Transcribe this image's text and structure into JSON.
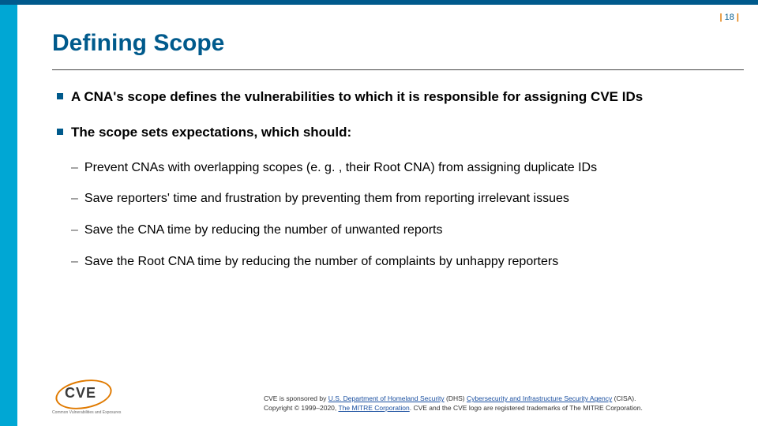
{
  "page": {
    "num": "18"
  },
  "title": "Defining Scope",
  "bullets": [
    {
      "level": 1,
      "text": "A CNA's scope defines the vulnerabilities to which it is responsible for assigning CVE IDs"
    },
    {
      "level": 1,
      "text": "The scope sets expectations, which should:"
    },
    {
      "level": 2,
      "text": "Prevent CNAs with overlapping scopes (e. g. , their Root CNA) from assigning duplicate IDs"
    },
    {
      "level": 2,
      "text": "Save reporters' time and frustration by preventing them from reporting irrelevant issues"
    },
    {
      "level": 2,
      "text": "Save the CNA time by reducing the number of unwanted reports"
    },
    {
      "level": 2,
      "text": "Save the Root CNA time by reducing the number of complaints by unhappy reporters"
    }
  ],
  "logo": {
    "text": "CVE",
    "sub": "Common Vulnerabilities and Exposures"
  },
  "footer": {
    "line1_a": "CVE is sponsored by ",
    "link1": "U.S. Department of Homeland Security",
    "line1_b": " (DHS) ",
    "link2": "Cybersecurity and Infrastructure Security Agency",
    "line1_c": " (CISA).",
    "line2_a": "Copyright © 1999–2020, ",
    "link3": "The MITRE Corporation",
    "line2_b": ". CVE and the CVE logo are registered trademarks of The MITRE Corporation."
  }
}
